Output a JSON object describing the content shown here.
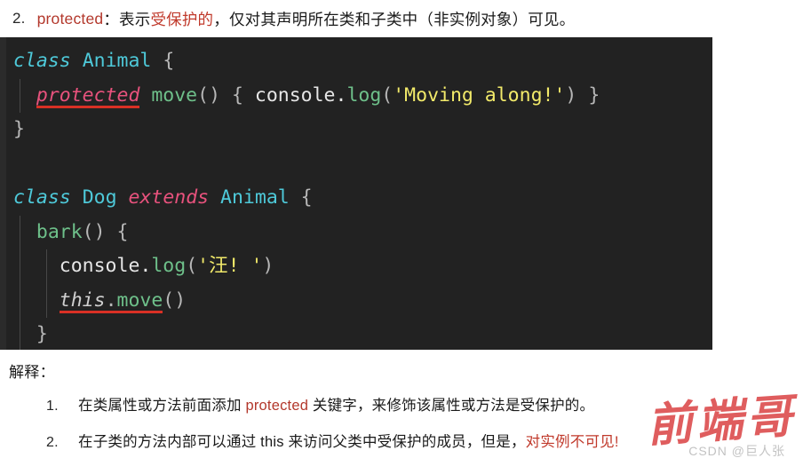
{
  "header": {
    "number": "2.",
    "keyword": "protected",
    "separator": "：表示",
    "highlight": "受保护的",
    "rest": "，仅对其声明所在类和子类中（非实例对象）可见。"
  },
  "code": {
    "language": "typescript",
    "background_color": "#222222",
    "colors": {
      "keyword": "#4ec9d9",
      "modifier": "#e8527d",
      "function": "#6ec08a",
      "string": "#f2ea6a",
      "plain": "#e6e6e6",
      "punctuation": "#b7b7b7",
      "underline": "#d93025"
    },
    "lines": [
      {
        "id": "line-1",
        "tokens": [
          {
            "text": "class",
            "type": "keyword"
          },
          {
            "text": " ",
            "type": "plain"
          },
          {
            "text": "Animal",
            "type": "type"
          },
          {
            "text": " ",
            "type": "plain"
          },
          {
            "text": "{",
            "type": "brace"
          }
        ]
      },
      {
        "id": "line-2",
        "tokens": [
          {
            "text": "  ",
            "type": "plain"
          },
          {
            "text": "protected",
            "type": "modifier",
            "underline": true
          },
          {
            "text": " ",
            "type": "plain"
          },
          {
            "text": "move",
            "type": "function"
          },
          {
            "text": "()",
            "type": "punctuation"
          },
          {
            "text": " ",
            "type": "plain"
          },
          {
            "text": "{",
            "type": "brace"
          },
          {
            "text": " ",
            "type": "plain"
          },
          {
            "text": "console",
            "type": "plain"
          },
          {
            "text": ".",
            "type": "plain"
          },
          {
            "text": "log",
            "type": "function"
          },
          {
            "text": "(",
            "type": "punctuation"
          },
          {
            "text": "'Moving along!'",
            "type": "string"
          },
          {
            "text": ")",
            "type": "punctuation"
          },
          {
            "text": " ",
            "type": "plain"
          },
          {
            "text": "}",
            "type": "brace"
          }
        ]
      },
      {
        "id": "line-3",
        "tokens": [
          {
            "text": "}",
            "type": "brace"
          }
        ]
      },
      {
        "id": "line-4",
        "tokens": []
      },
      {
        "id": "line-5",
        "tokens": [
          {
            "text": "class",
            "type": "keyword"
          },
          {
            "text": " ",
            "type": "plain"
          },
          {
            "text": "Dog",
            "type": "type"
          },
          {
            "text": " ",
            "type": "plain"
          },
          {
            "text": "extends",
            "type": "modifier"
          },
          {
            "text": " ",
            "type": "plain"
          },
          {
            "text": "Animal",
            "type": "type"
          },
          {
            "text": " ",
            "type": "plain"
          },
          {
            "text": "{",
            "type": "brace"
          }
        ]
      },
      {
        "id": "line-6",
        "tokens": [
          {
            "text": "  ",
            "type": "plain"
          },
          {
            "text": "bark",
            "type": "function"
          },
          {
            "text": "()",
            "type": "punctuation"
          },
          {
            "text": " ",
            "type": "plain"
          },
          {
            "text": "{",
            "type": "brace"
          }
        ]
      },
      {
        "id": "line-7",
        "tokens": [
          {
            "text": "    ",
            "type": "plain"
          },
          {
            "text": "console",
            "type": "plain"
          },
          {
            "text": ".",
            "type": "plain"
          },
          {
            "text": "log",
            "type": "function"
          },
          {
            "text": "(",
            "type": "punctuation"
          },
          {
            "text": "'汪! '",
            "type": "string"
          },
          {
            "text": ")",
            "type": "punctuation"
          }
        ]
      },
      {
        "id": "line-8",
        "tokens": [
          {
            "text": "    ",
            "type": "plain"
          },
          {
            "text": "this",
            "type": "this",
            "underline": true
          },
          {
            "text": ".",
            "type": "punctuation",
            "underline": true
          },
          {
            "text": "move",
            "type": "function",
            "underline": true
          },
          {
            "text": "()",
            "type": "punctuation"
          }
        ]
      },
      {
        "id": "line-9",
        "tokens": [
          {
            "text": "  ",
            "type": "plain"
          },
          {
            "text": "}",
            "type": "brace"
          }
        ]
      },
      {
        "id": "line-10",
        "tokens": [
          {
            "text": "}",
            "type": "brace"
          }
        ]
      }
    ]
  },
  "explanation": {
    "label": "解释：",
    "items": [
      {
        "number": "1.",
        "pre": "在类属性或方法前面添加 ",
        "keyword": "protected",
        "post": " 关键字，来修饰该属性或方法是受保护的。",
        "tail": "",
        "tail_red": ""
      },
      {
        "number": "2.",
        "pre": "在子类的方法内部可以通过 this 来访问父类中受保护的成员，但是，",
        "keyword": "",
        "post": "",
        "tail_red": "对实例不可见!",
        "tail": ""
      }
    ]
  },
  "watermark": {
    "brand": "前端哥",
    "source": "CSDN @巨人张"
  }
}
